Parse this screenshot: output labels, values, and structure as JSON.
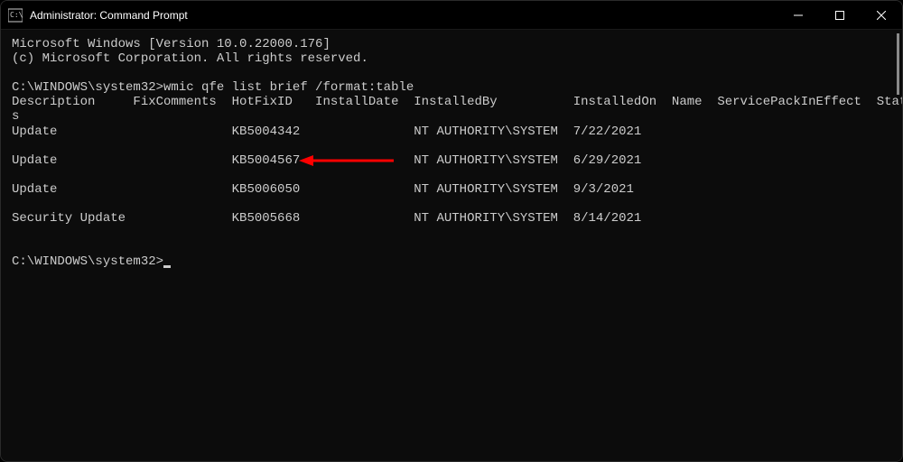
{
  "titlebar": {
    "title": "Administrator: Command Prompt"
  },
  "terminal": {
    "header_version": "Microsoft Windows [Version 10.0.22000.176]",
    "header_copyright": "(c) Microsoft Corporation. All rights reserved.",
    "prompt_path": "C:\\WINDOWS\\system32>",
    "command": "wmic qfe list brief /format:table",
    "columns_line1": "Description     FixComments  HotFixID   InstallDate  InstalledBy          InstalledOn  Name  ServicePackInEffect  Statu",
    "columns_line2": "s",
    "rows": [
      "Update                       KB5004342               NT AUTHORITY\\SYSTEM  7/22/2021",
      "",
      "Update                       KB5004567               NT AUTHORITY\\SYSTEM  6/29/2021",
      "",
      "Update                       KB5006050               NT AUTHORITY\\SYSTEM  9/3/2021",
      "",
      "Security Update              KB5005668               NT AUTHORITY\\SYSTEM  8/14/2021"
    ],
    "final_prompt": "C:\\WINDOWS\\system32>"
  },
  "annotation": {
    "arrow_color": "#ff0000",
    "highlighted_hotfix": "KB5004567"
  }
}
